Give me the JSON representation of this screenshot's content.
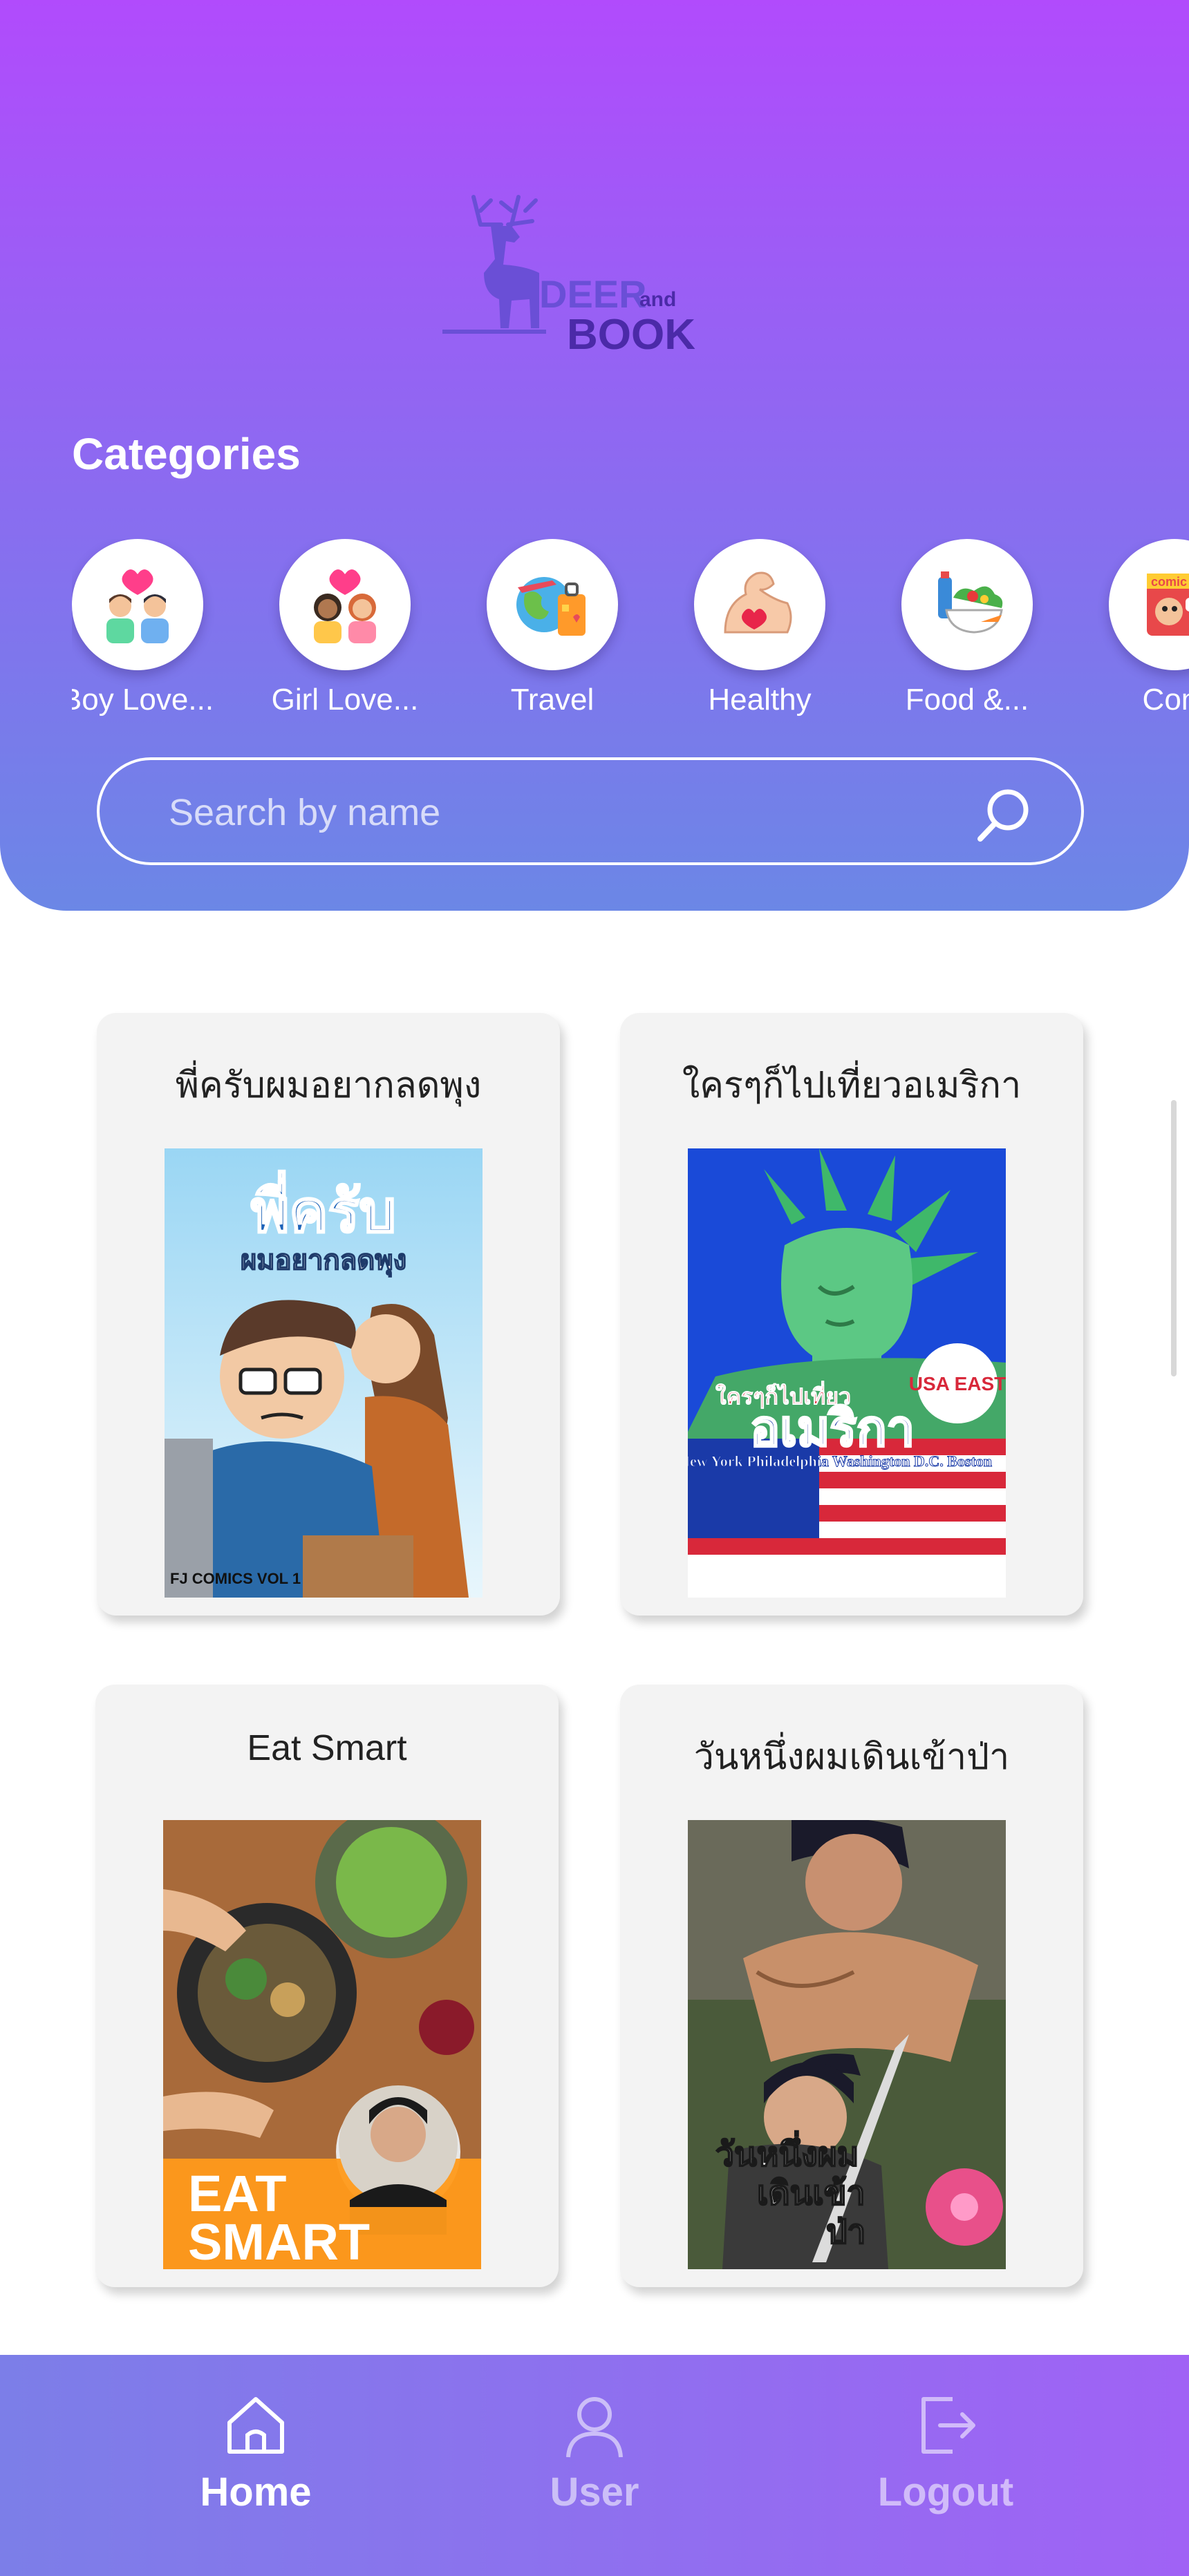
{
  "app": {
    "logo_text_1": "DEER",
    "logo_text_2": "and",
    "logo_text_3": "BOOK"
  },
  "categories": {
    "title": "Categories",
    "items": [
      {
        "label": "Boy Love...",
        "icon": "boy-love-icon"
      },
      {
        "label": "Girl Love...",
        "icon": "girl-love-icon"
      },
      {
        "label": "Travel",
        "icon": "travel-icon"
      },
      {
        "label": "Healthy",
        "icon": "healthy-icon"
      },
      {
        "label": "Food &...",
        "icon": "food-icon"
      },
      {
        "label": "Com",
        "icon": "comic-icon"
      }
    ]
  },
  "search": {
    "placeholder": "Search by name"
  },
  "books": [
    {
      "title": "พี่ครับผมอยากลดพุง",
      "cover_title": "พี่ครับ",
      "cover_subtitle": "ผมอยากลดพุง",
      "cover_note": "FJ COMICS VOL 1"
    },
    {
      "title": "ใครๆก็ไปเที่ยวอเมริกา",
      "cover_title": "อเมริกา",
      "cover_subtitle": "ใครๆก็ไปเที่ยว",
      "cover_badge": "USA EAST",
      "cover_cities": "New York Philadelphia Washington D.C. Boston"
    },
    {
      "title": "Eat Smart",
      "cover_title_1": "EAT",
      "cover_title_2": "SMART"
    },
    {
      "title": "วันหนึ่งผมเดินเข้าป่า",
      "cover_title_1": "วันหนึ่งผม",
      "cover_title_2": "เดินเข้า",
      "cover_title_3": "ป่า"
    }
  ],
  "nav": {
    "home": "Home",
    "user": "User",
    "logout": "Logout"
  },
  "colors": {
    "header_top": "#b14bfc",
    "header_bottom": "#6b87e6",
    "nav_left": "#7c7ee8",
    "nav_right": "#a062f5",
    "card_bg": "#f3f3f3"
  }
}
